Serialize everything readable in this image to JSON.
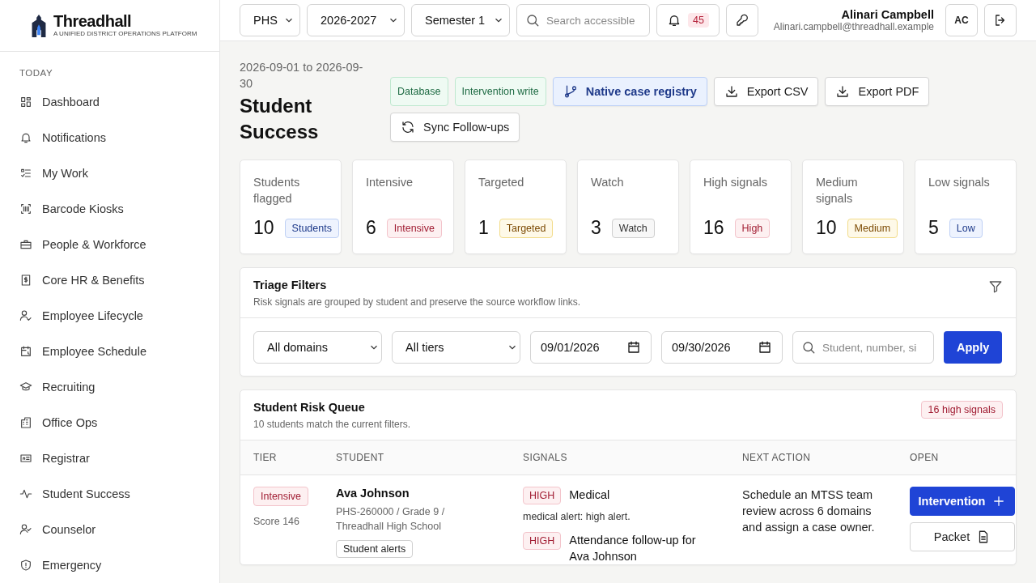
{
  "brand": {
    "name": "Threadhall",
    "tagline": "A UNIFIED DISTRICT OPERATIONS PLATFORM"
  },
  "sidebar": {
    "section": "TODAY",
    "items": [
      "Dashboard",
      "Notifications",
      "My Work",
      "Barcode Kiosks",
      "People & Workforce",
      "Core HR & Benefits",
      "Employee Lifecycle",
      "Employee Schedule",
      "Recruiting",
      "Office Ops",
      "Registrar",
      "Student Success",
      "Counselor",
      "Emergency"
    ]
  },
  "topbar": {
    "selects": [
      "PHS",
      "2026-2027",
      "Semester 1"
    ],
    "search_placeholder": "Search accessible",
    "notifications": "45",
    "user": {
      "name": "Alinari Campbell",
      "email": "Alinari.campbell@threadhall.example",
      "initials": "AC"
    }
  },
  "header": {
    "date_range": "2026-09-01 to 2026-09-30",
    "title": "Student Success",
    "actions": [
      {
        "kind": "tag",
        "label": "Database"
      },
      {
        "kind": "tag",
        "label": "Intervention write"
      },
      {
        "kind": "accent",
        "label": "Native case registry"
      },
      {
        "kind": "download",
        "label": "Export CSV"
      },
      {
        "kind": "download",
        "label": "Export PDF"
      },
      {
        "kind": "sync",
        "label": "Sync Follow-ups"
      }
    ]
  },
  "stats": [
    {
      "label": "Students flagged",
      "value": "10",
      "badge": "Students",
      "kind": "info"
    },
    {
      "label": "Intensive",
      "value": "6",
      "badge": "Intensive",
      "kind": "danger"
    },
    {
      "label": "Targeted",
      "value": "1",
      "badge": "Targeted",
      "kind": "warning"
    },
    {
      "label": "Watch",
      "value": "3",
      "badge": "Watch",
      "kind": "neutral"
    },
    {
      "label": "High signals",
      "value": "16",
      "badge": "High",
      "kind": "danger"
    },
    {
      "label": "Medium signals",
      "value": "10",
      "badge": "Medium",
      "kind": "warning"
    },
    {
      "label": "Low signals",
      "value": "5",
      "badge": "Low",
      "kind": "info"
    }
  ],
  "filters": {
    "title": "Triage Filters",
    "subtitle": "Risk signals are grouped by student and preserve the source workflow links.",
    "domain": "All domains",
    "tier": "All tiers",
    "from": "09/01/2026",
    "to": "09/30/2026",
    "search_placeholder": "Student, number, si",
    "apply": "Apply"
  },
  "queue": {
    "title": "Student Risk Queue",
    "subtitle": "10 students match the current filters.",
    "badge": "16 high signals",
    "columns": [
      "TIER",
      "STUDENT",
      "SIGNALS",
      "NEXT ACTION",
      "OPEN"
    ],
    "rows": [
      {
        "tier": "Intensive",
        "kind": "danger",
        "score": "Score 146",
        "student": "Ava Johnson",
        "meta": "PHS-260000 / Grade 9 / Threadhall High School",
        "tags": [
          "Student alerts"
        ],
        "signals": [
          {
            "level": "HIGH",
            "kind": "danger",
            "title": "Medical",
            "detail": "medical alert: high alert."
          },
          {
            "level": "HIGH",
            "kind": "danger",
            "title": "Attendance follow-up for Ava Johnson"
          }
        ],
        "next_action": "Schedule an MTSS team review across 6 domains and assign a case owner.",
        "buttons": [
          {
            "kind": "primary",
            "label": "Intervention"
          },
          {
            "kind": "packet",
            "label": "Packet"
          }
        ]
      }
    ]
  }
}
